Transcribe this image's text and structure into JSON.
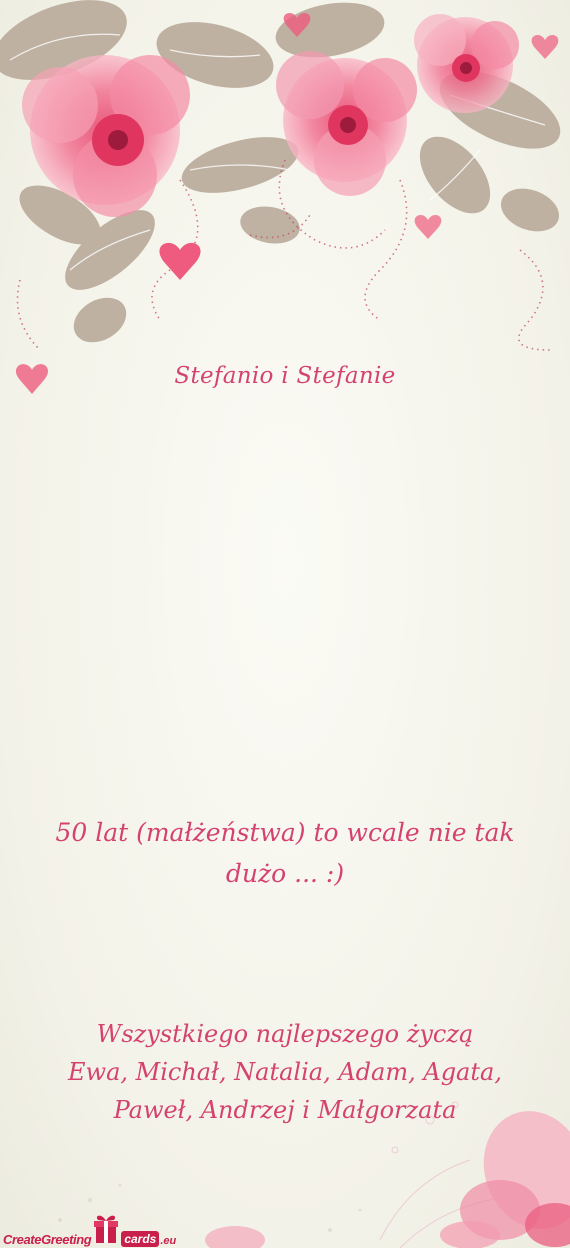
{
  "card": {
    "names": "Stefanio i Stefanie",
    "message": "50 lat (małżeństwa) to wcale nie tak dużo ... :)",
    "signature": {
      "line1": "Wszystkiego najlepszego życzą",
      "line2": "Ewa, Michał, Natalia, Adam, Agata,",
      "line3": "Paweł, Andrzej i Małgorzata"
    }
  },
  "branding": {
    "name_part": "CreateGreeting",
    "badge_part": "cards",
    "suffix": ".eu"
  },
  "colors": {
    "text": "#d4436e",
    "flower_pink": "#f07a98",
    "leaf_tan": "#b7a999",
    "brand": "#c91f4b"
  },
  "icons": [
    "flower-icon",
    "leaf-icon",
    "heart-icon",
    "gift-icon"
  ]
}
